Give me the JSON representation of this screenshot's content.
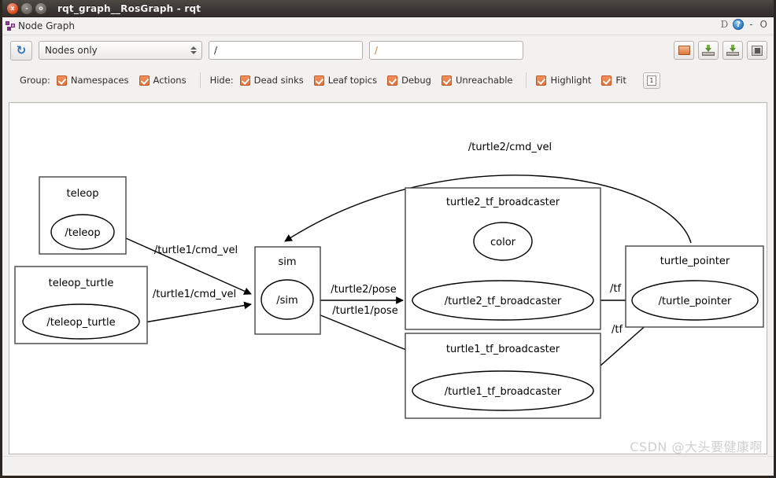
{
  "window": {
    "title": "rqt_graph__RosGraph - rqt",
    "buttons": {
      "close": "x",
      "minimize": "-",
      "maximize": "o"
    }
  },
  "dock": {
    "title": "Node Graph",
    "icon": "graph-icon",
    "d_label": "D",
    "help_label": "?",
    "minimize_label": "-",
    "close_label": "O"
  },
  "toolbar": {
    "refresh_icon": "refresh-icon",
    "refresh_glyph": "↻",
    "filter_select": {
      "value": "Nodes only"
    },
    "topic_filter": {
      "value": "/",
      "placeholder": "/"
    },
    "node_filter": {
      "value": "/",
      "placeholder": "/"
    },
    "buttons": [
      {
        "name": "load-dot-button",
        "icon": "folder-icon"
      },
      {
        "name": "save-dot-button",
        "icon": "save-dot-icon"
      },
      {
        "name": "save-svg-button",
        "icon": "save-svg-icon"
      },
      {
        "name": "save-image-button",
        "icon": "image-icon"
      }
    ]
  },
  "filters": {
    "group_label": "Group:",
    "group_items": [
      {
        "label": "Namespaces",
        "checked": true
      },
      {
        "label": "Actions",
        "checked": true
      }
    ],
    "hide_label": "Hide:",
    "hide_items": [
      {
        "label": "Dead sinks",
        "checked": true
      },
      {
        "label": "Leaf topics",
        "checked": true
      },
      {
        "label": "Debug",
        "checked": true
      },
      {
        "label": "Unreachable",
        "checked": true
      }
    ],
    "view_items": [
      {
        "label": "Highlight",
        "checked": true
      },
      {
        "label": "Fit",
        "checked": true
      }
    ],
    "zoom_button_label": "1",
    "checkbox_color": "#e4703a"
  },
  "graph": {
    "clusters": [
      {
        "id": "teleop",
        "label": "teleop"
      },
      {
        "id": "teleop_turtle",
        "label": "teleop_turtle"
      },
      {
        "id": "sim",
        "label": "sim"
      },
      {
        "id": "turtle2_tf_broadcaster",
        "label": "turtle2_tf_broadcaster"
      },
      {
        "id": "turtle1_tf_broadcaster",
        "label": "turtle1_tf_broadcaster"
      },
      {
        "id": "turtle_pointer",
        "label": "turtle_pointer"
      }
    ],
    "nodes": [
      {
        "id": "n_teleop",
        "label": "/teleop"
      },
      {
        "id": "n_teleop_turtle",
        "label": "/teleop_turtle"
      },
      {
        "id": "n_sim",
        "label": "/sim"
      },
      {
        "id": "n_color",
        "label": "color"
      },
      {
        "id": "n_t2tf",
        "label": "/turtle2_tf_broadcaster"
      },
      {
        "id": "n_t1tf",
        "label": "/turtle1_tf_broadcaster"
      },
      {
        "id": "n_pointer",
        "label": "/turtle_pointer"
      }
    ],
    "edges": [
      {
        "id": "e1",
        "label": "/turtle1/cmd_vel",
        "from": "n_teleop",
        "to": "n_sim"
      },
      {
        "id": "e2",
        "label": "/turtle1/cmd_vel",
        "from": "n_teleop_turtle",
        "to": "n_sim"
      },
      {
        "id": "e3",
        "label": "/turtle2/pose",
        "from": "n_sim",
        "to": "n_t2tf"
      },
      {
        "id": "e4",
        "label": "/turtle1/pose",
        "from": "n_sim",
        "to": "n_t1tf"
      },
      {
        "id": "e5",
        "label": "/tf",
        "from": "n_t2tf",
        "to": "n_pointer"
      },
      {
        "id": "e6",
        "label": "/tf",
        "from": "n_t1tf",
        "to": "n_pointer"
      },
      {
        "id": "e7",
        "label": "/turtle2/cmd_vel",
        "from": "n_pointer",
        "to": "n_sim"
      }
    ]
  },
  "watermark": {
    "text": "CSDN @大头要健康啊"
  }
}
